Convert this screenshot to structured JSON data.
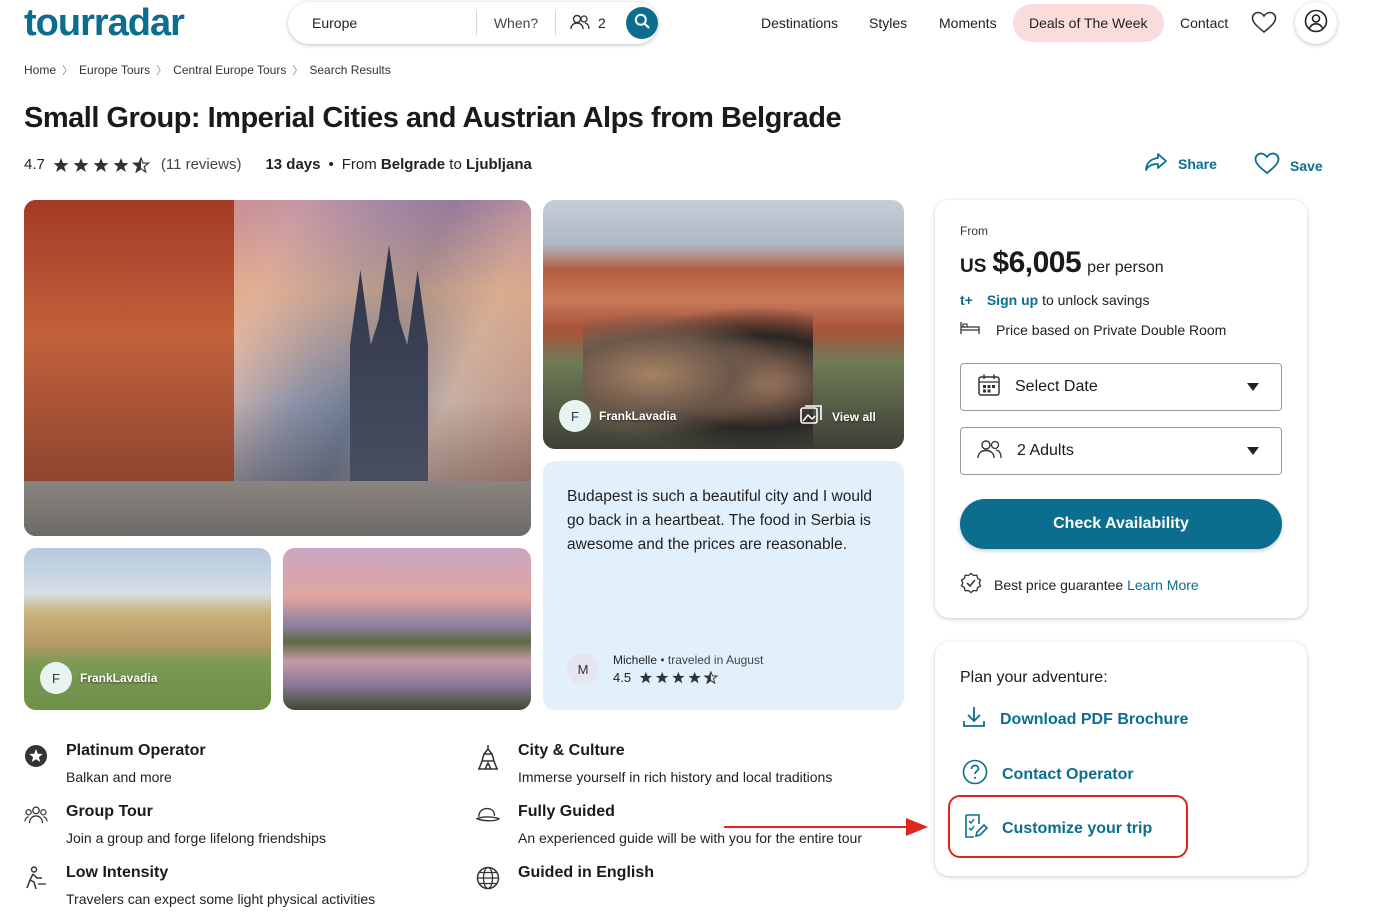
{
  "header": {
    "logo": "tourradar",
    "logo_tm": "™",
    "search": {
      "destination": "Europe",
      "when": "When?",
      "travelers": "2"
    },
    "nav": {
      "destinations": "Destinations",
      "styles": "Styles",
      "moments": "Moments",
      "deals": "Deals of The Week",
      "contact": "Contact"
    },
    "accent_color": "#0b6e8f",
    "deals_bg": "#fbdcdc"
  },
  "breadcrumb": [
    "Home",
    "Europe Tours",
    "Central Europe Tours",
    "Search Results"
  ],
  "tour": {
    "title": "Small Group: Imperial Cities and Austrian Alps from Belgrade",
    "rating": "4.7",
    "reviews": "(11 reviews)",
    "days": "13 days",
    "from_label": "From",
    "from_city": "Belgrade",
    "to_label": "to",
    "to_city": "Ljubljana",
    "share": "Share",
    "save": "Save"
  },
  "gallery": {
    "credit_initial": "F",
    "credit_name": "FrankLavadia",
    "view_all": "View all",
    "credit2_initial": "F",
    "credit2_name": "FrankLavadia"
  },
  "review": {
    "text": "Budapest is such a beautiful city and I would go back in a heartbeat. The food in Serbia is awesome and the prices are reasonable.",
    "initial": "M",
    "name": "Michelle",
    "traveled": "traveled in August",
    "rating": "4.5"
  },
  "features": [
    {
      "title": "Platinum Operator",
      "desc": "Balkan and more",
      "icon": "star-badge-icon"
    },
    {
      "title": "City & Culture",
      "desc": "Immerse yourself in rich history and local traditions",
      "icon": "landmark-icon"
    },
    {
      "title": "Group Tour",
      "desc": "Join a group and forge lifelong friendships",
      "icon": "group-icon"
    },
    {
      "title": "Fully Guided",
      "desc": "An experienced guide will be with you for the entire tour",
      "icon": "guide-hat-icon"
    },
    {
      "title": "Low Intensity",
      "desc": "Travelers can expect some light physical activities",
      "icon": "walking-icon"
    },
    {
      "title": "Guided in English",
      "desc": "",
      "icon": "globe-icon"
    }
  ],
  "pricing": {
    "from": "From",
    "currency": "US",
    "amount": "$6,005",
    "per": "per person",
    "tplus": "t+",
    "signup_link": "Sign up",
    "signup_rest": "to unlock savings",
    "based": "Price based on Private Double Room",
    "select_date": "Select Date",
    "adults": "2 Adults",
    "check": "Check Availability",
    "guarantee": "Best price guarantee",
    "learn_more": "Learn More"
  },
  "plan": {
    "title": "Plan your adventure:",
    "download": "Download PDF Brochure",
    "contact": "Contact Operator",
    "customize": "Customize your trip"
  },
  "annotation_color": "#e0251b"
}
